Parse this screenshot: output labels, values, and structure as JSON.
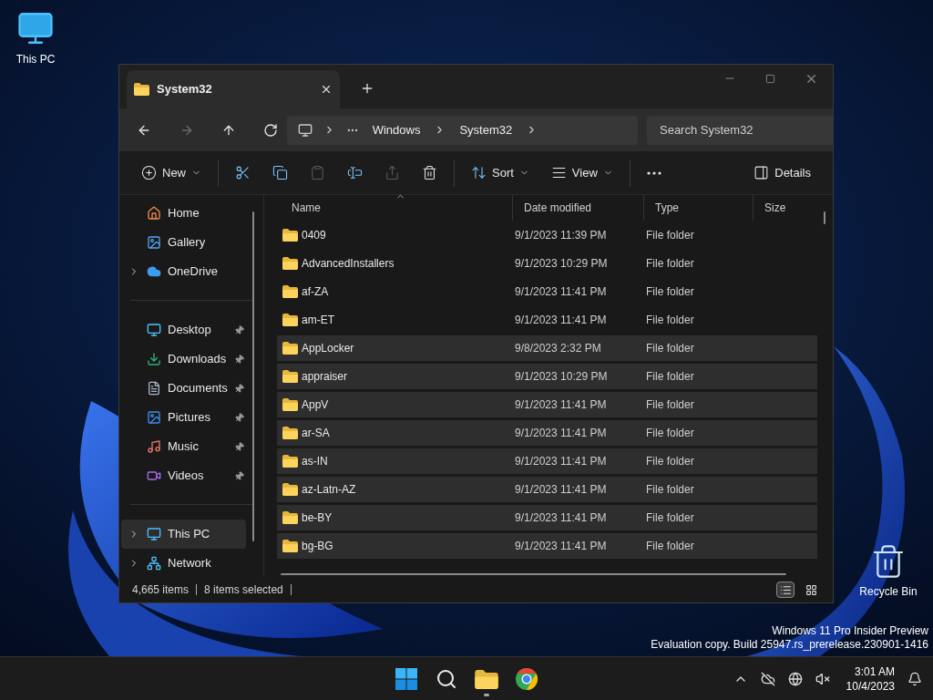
{
  "desktop_icons": [
    {
      "kind": "pc",
      "label": "This PC"
    },
    {
      "kind": "bin",
      "label": "Recycle Bin"
    }
  ],
  "window": {
    "tab": {
      "title": "System32"
    },
    "nav": [
      {
        "kind": "back",
        "disabled": false
      },
      {
        "kind": "forward",
        "disabled": true
      },
      {
        "kind": "up",
        "disabled": false
      },
      {
        "kind": "refresh",
        "disabled": false
      }
    ],
    "breadcrumb": [
      "Windows",
      "System32"
    ],
    "search": {
      "placeholder": "Search System32"
    },
    "toolbar": [
      {
        "kind": "new",
        "label": "New",
        "disabled": false
      },
      {
        "kind": "cut",
        "disabled": false
      },
      {
        "kind": "copy",
        "disabled": false
      },
      {
        "kind": "paste",
        "disabled": true
      },
      {
        "kind": "rename",
        "disabled": false
      },
      {
        "kind": "share",
        "disabled": true
      },
      {
        "kind": "delete",
        "disabled": false
      },
      {
        "kind": "sort",
        "label": "Sort",
        "disabled": false
      },
      {
        "kind": "view",
        "label": "View",
        "disabled": false
      },
      {
        "kind": "more",
        "disabled": false
      },
      {
        "kind": "details",
        "label": "Details",
        "disabled": false
      }
    ],
    "sidebar": [
      [
        {
          "kind": "home",
          "label": "Home",
          "selected": false
        },
        {
          "kind": "gallery",
          "label": "Gallery",
          "selected": false
        },
        {
          "kind": "cloud",
          "label": "OneDrive",
          "selected": false,
          "expanded": false
        }
      ],
      [
        {
          "kind": "desktop",
          "label": "Desktop",
          "selected": false,
          "pinned": true
        },
        {
          "kind": "downloads",
          "label": "Downloads",
          "selected": false,
          "pinned": true
        },
        {
          "kind": "documents",
          "label": "Documents",
          "selected": false,
          "pinned": true
        },
        {
          "kind": "pictures",
          "label": "Pictures",
          "selected": false,
          "pinned": true
        },
        {
          "kind": "music",
          "label": "Music",
          "selected": false,
          "pinned": true
        },
        {
          "kind": "videos",
          "label": "Videos",
          "selected": false,
          "pinned": true
        }
      ],
      [
        {
          "kind": "pc",
          "label": "This PC",
          "selected": true,
          "expanded": false
        },
        {
          "kind": "network",
          "label": "Network",
          "selected": false,
          "expanded": false
        }
      ]
    ],
    "sort_ascending": true,
    "columns": [
      {
        "label": "Name"
      },
      {
        "label": "Date modified"
      },
      {
        "label": "Type"
      },
      {
        "label": "Size"
      }
    ],
    "rows": [
      {
        "name": "0409",
        "date": "9/1/2023 11:39 PM",
        "type": "File folder",
        "selected": false
      },
      {
        "name": "AdvancedInstallers",
        "date": "9/1/2023 10:29 PM",
        "type": "File folder",
        "selected": false
      },
      {
        "name": "af-ZA",
        "date": "9/1/2023 11:41 PM",
        "type": "File folder",
        "selected": false
      },
      {
        "name": "am-ET",
        "date": "9/1/2023 11:41 PM",
        "type": "File folder",
        "selected": false
      },
      {
        "name": "AppLocker",
        "date": "9/8/2023 2:32 PM",
        "type": "File folder",
        "selected": true
      },
      {
        "name": "appraiser",
        "date": "9/1/2023 10:29 PM",
        "type": "File folder",
        "selected": true
      },
      {
        "name": "AppV",
        "date": "9/1/2023 11:41 PM",
        "type": "File folder",
        "selected": true
      },
      {
        "name": "ar-SA",
        "date": "9/1/2023 11:41 PM",
        "type": "File folder",
        "selected": true
      },
      {
        "name": "as-IN",
        "date": "9/1/2023 11:41 PM",
        "type": "File folder",
        "selected": true
      },
      {
        "name": "az-Latn-AZ",
        "date": "9/1/2023 11:41 PM",
        "type": "File folder",
        "selected": true
      },
      {
        "name": "be-BY",
        "date": "9/1/2023 11:41 PM",
        "type": "File folder",
        "selected": true
      },
      {
        "name": "bg-BG",
        "date": "9/1/2023 11:41 PM",
        "type": "File folder",
        "selected": true
      }
    ],
    "status_bar": {
      "count": "4,665 items",
      "selection": "8 items selected"
    },
    "view_modes": [
      {
        "kind": "details",
        "selected": true
      },
      {
        "kind": "tiles",
        "selected": false
      }
    ]
  },
  "watermark": [
    "Windows 11 Pro Insider Preview",
    "Evaluation copy. Build 25947.rs_prerelease.230901-1416"
  ],
  "taskbar": {
    "apps": [
      {
        "kind": "start",
        "running": false
      },
      {
        "kind": "search",
        "running": false
      },
      {
        "kind": "explorer",
        "running": true
      },
      {
        "kind": "chrome",
        "running": false
      }
    ],
    "tray": [
      {
        "kind": "chevron"
      },
      {
        "kind": "cloud-off"
      },
      {
        "kind": "globe"
      },
      {
        "kind": "mute"
      }
    ],
    "time": "3:01 AM",
    "date": "10/4/2023"
  }
}
